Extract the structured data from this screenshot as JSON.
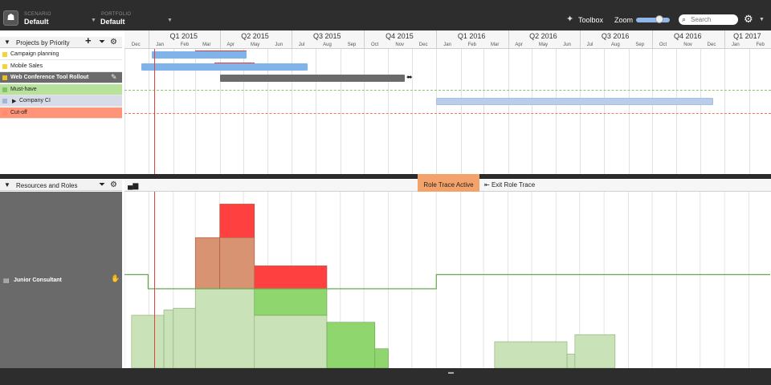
{
  "header": {
    "scenario_label": "SCENARIO",
    "scenario_value": "Default",
    "portfolio_label": "PORTFOLIO",
    "portfolio_value": "Default",
    "toolbox_label": "Toolbox",
    "zoom_label": "Zoom",
    "zoom_level": 0.6,
    "search_placeholder": "Search"
  },
  "projects_panel": {
    "title": "Projects by Priority",
    "rows": [
      {
        "label": "Campaign planning",
        "kind": "project",
        "marker_color": "#f5d33b"
      },
      {
        "label": "Mobile Sales",
        "kind": "project",
        "marker_color": "#f5d33b"
      },
      {
        "label": "Web Conference Tool Rollout",
        "kind": "project-selected",
        "marker_color": "#e6c02a"
      },
      {
        "label": "Must-have",
        "kind": "milestone-band",
        "marker_color": "#7fc36a"
      },
      {
        "label": "Company CI",
        "kind": "group",
        "marker_color": "#9fb6dd"
      },
      {
        "label": "Cut-off",
        "kind": "cutoff-band",
        "marker_color": "#ff8a6e"
      }
    ]
  },
  "timeline": {
    "quarters": [
      "Q1 2015",
      "Q2 2015",
      "Q3 2015",
      "Q4 2015",
      "Q1 2016",
      "Q2 2016",
      "Q3 2016",
      "Q4 2016",
      "Q1 2017"
    ],
    "months": [
      "Dec",
      "Jan",
      "Feb",
      "Mar",
      "Apr",
      "May",
      "Jun",
      "Jul",
      "Aug",
      "Sep",
      "Oct",
      "Nov",
      "Dec",
      "Jan",
      "Feb",
      "Mar",
      "Apr",
      "May",
      "Jun",
      "Jul",
      "Aug",
      "Sep",
      "Oct",
      "Nov",
      "Dec",
      "Jan",
      "Feb"
    ],
    "gantt": [
      {
        "name": "campaign-planning-bar",
        "row": 0,
        "start": "2015-01-05",
        "end": "2015-05-05",
        "color": "#7fb3ea",
        "progress_end": "2015-05-05",
        "progress_start": "2015-03-01"
      },
      {
        "name": "mobile-sales-bar",
        "row": 1,
        "start": "2014-12-22",
        "end": "2015-07-22",
        "color": "#7fb3ea",
        "progress_start": "2015-03-25",
        "progress_end": "2015-05-15"
      },
      {
        "name": "web-conference-bar",
        "row": 2,
        "start": "2015-04-01",
        "end": "2015-11-22",
        "color": "#6b6b6b"
      },
      {
        "name": "company-ci-bar",
        "row": 4,
        "start": "2016-01-01",
        "end": "2016-12-18",
        "color": "#b7cde9"
      }
    ],
    "today": "2015-01-10"
  },
  "resources_panel": {
    "title": "Resources and Roles",
    "role_trace_active": "Role Trace Active",
    "exit_role_trace": "Exit Role Trace",
    "resource_label": "Junior Consultant"
  },
  "chart_data": {
    "type": "area",
    "title": "",
    "xlabel": "",
    "ylabel": "",
    "x_range": [
      "2014-12-01",
      "2017-02-28"
    ],
    "capacity_line": [
      {
        "from": "2014-12-01",
        "to": "2014-12-31",
        "value": 5.3
      },
      {
        "from": "2014-12-31",
        "to": "2016-01-01",
        "value": 4.5
      },
      {
        "from": "2016-01-01",
        "to": "2017-02-28",
        "value": 5.3
      }
    ],
    "demand_steps": [
      {
        "from": "2014-12-10",
        "to": "2015-01-20",
        "value": 3.0,
        "category": "assigned"
      },
      {
        "from": "2015-01-20",
        "to": "2015-02-01",
        "value": 3.3,
        "category": "assigned"
      },
      {
        "from": "2015-02-01",
        "to": "2015-03-01",
        "value": 3.4,
        "category": "assigned"
      },
      {
        "from": "2015-03-01",
        "to": "2015-05-15",
        "value": 4.5,
        "category": "assigned"
      },
      {
        "from": "2015-05-15",
        "to": "2015-08-15",
        "value": 3.0,
        "category": "assigned"
      },
      {
        "from": "2016-03-15",
        "to": "2016-06-15",
        "value": 1.5,
        "category": "assigned"
      },
      {
        "from": "2016-06-15",
        "to": "2016-06-25",
        "value": 0.8,
        "category": "assigned"
      },
      {
        "from": "2016-06-25",
        "to": "2016-08-15",
        "value": 1.9,
        "category": "assigned"
      }
    ],
    "traced_steps": [
      {
        "from": "2015-05-15",
        "to": "2015-08-15",
        "base": 3.0,
        "value": 4.5,
        "color": "#8fd66f"
      },
      {
        "from": "2015-08-15",
        "to": "2015-10-15",
        "base": 0,
        "value": 2.6,
        "color": "#8fd66f"
      },
      {
        "from": "2015-10-15",
        "to": "2015-11-01",
        "base": 0,
        "value": 1.1,
        "color": "#8fd66f"
      }
    ],
    "over_steps": [
      {
        "from": "2015-03-01",
        "to": "2015-04-01",
        "base": 4.5,
        "value": 7.4,
        "color": "#d89373"
      },
      {
        "from": "2015-04-01",
        "to": "2015-05-15",
        "base": 4.5,
        "value": 9.3,
        "color": "#ff4040"
      },
      {
        "from": "2015-04-01",
        "to": "2015-05-15",
        "base": 4.5,
        "value": 7.4,
        "color": "#d89373"
      },
      {
        "from": "2015-05-15",
        "to": "2015-08-15",
        "base": 4.5,
        "value": 5.8,
        "color": "#ff4040"
      }
    ],
    "ylim": [
      0,
      10
    ]
  }
}
